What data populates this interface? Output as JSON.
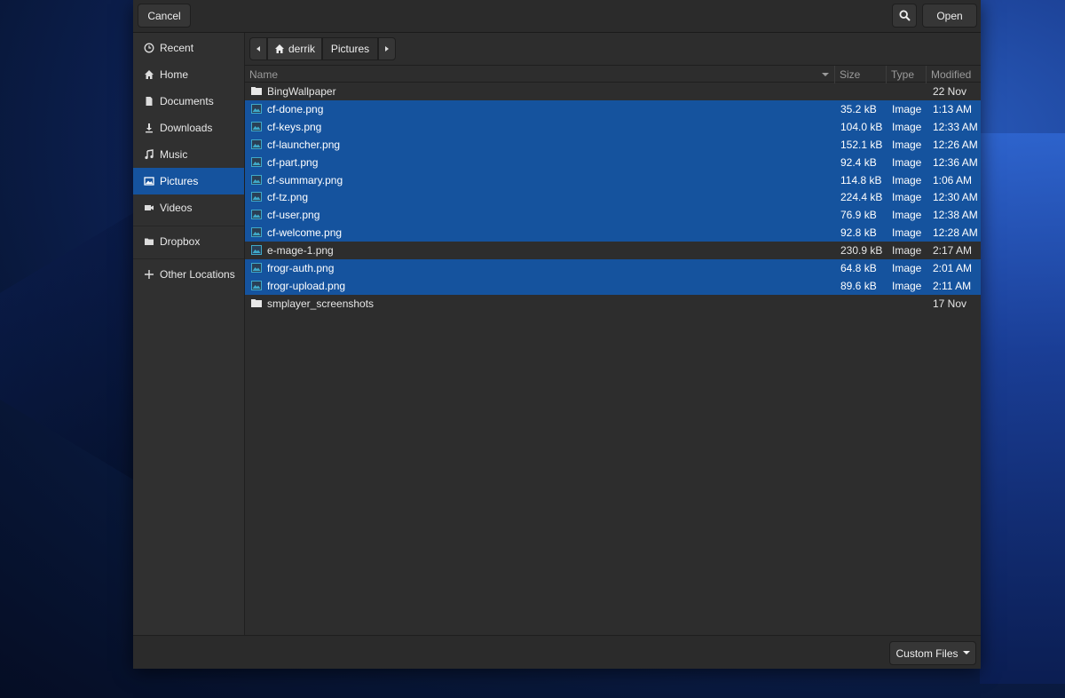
{
  "header": {
    "cancel_label": "Cancel",
    "open_label": "Open",
    "search_icon": "search-icon"
  },
  "sidebar": {
    "items": [
      {
        "label": "Recent",
        "icon": "clock-icon"
      },
      {
        "label": "Home",
        "icon": "home-icon"
      },
      {
        "label": "Documents",
        "icon": "document-icon"
      },
      {
        "label": "Downloads",
        "icon": "download-icon"
      },
      {
        "label": "Music",
        "icon": "music-icon"
      },
      {
        "label": "Pictures",
        "icon": "image-icon",
        "selected": true
      },
      {
        "label": "Videos",
        "icon": "video-icon"
      },
      {
        "label": "Dropbox",
        "icon": "folder-icon"
      },
      {
        "label": "Other Locations",
        "icon": "plus-icon"
      }
    ]
  },
  "pathbar": {
    "home_label": "derrik",
    "current_label": "Pictures"
  },
  "columns": {
    "name": "Name",
    "size": "Size",
    "type": "Type",
    "modified": "Modified"
  },
  "files": [
    {
      "name": "BingWallpaper",
      "size": "",
      "type": "",
      "modified": "22 Nov",
      "kind": "folder",
      "selected": false
    },
    {
      "name": "cf-done.png",
      "size": "35.2 kB",
      "type": "Image",
      "modified": "1:13 AM",
      "kind": "image",
      "selected": true
    },
    {
      "name": "cf-keys.png",
      "size": "104.0 kB",
      "type": "Image",
      "modified": "12:33 AM",
      "kind": "image",
      "selected": true
    },
    {
      "name": "cf-launcher.png",
      "size": "152.1 kB",
      "type": "Image",
      "modified": "12:26 AM",
      "kind": "image",
      "selected": true
    },
    {
      "name": "cf-part.png",
      "size": "92.4 kB",
      "type": "Image",
      "modified": "12:36 AM",
      "kind": "image",
      "selected": true
    },
    {
      "name": "cf-summary.png",
      "size": "114.8 kB",
      "type": "Image",
      "modified": "1:06 AM",
      "kind": "image",
      "selected": true
    },
    {
      "name": "cf-tz.png",
      "size": "224.4 kB",
      "type": "Image",
      "modified": "12:30 AM",
      "kind": "image",
      "selected": true
    },
    {
      "name": "cf-user.png",
      "size": "76.9 kB",
      "type": "Image",
      "modified": "12:38 AM",
      "kind": "image",
      "selected": true
    },
    {
      "name": "cf-welcome.png",
      "size": "92.8 kB",
      "type": "Image",
      "modified": "12:28 AM",
      "kind": "image",
      "selected": true
    },
    {
      "name": "e-mage-1.png",
      "size": "230.9 kB",
      "type": "Image",
      "modified": "2:17 AM",
      "kind": "image",
      "selected": false
    },
    {
      "name": "frogr-auth.png",
      "size": "64.8 kB",
      "type": "Image",
      "modified": "2:01 AM",
      "kind": "image",
      "selected": true
    },
    {
      "name": "frogr-upload.png",
      "size": "89.6 kB",
      "type": "Image",
      "modified": "2:11 AM",
      "kind": "image",
      "selected": true
    },
    {
      "name": "smplayer_screenshots",
      "size": "",
      "type": "",
      "modified": "17 Nov",
      "kind": "folder",
      "selected": false
    }
  ],
  "footer": {
    "filter_label": "Custom Files"
  },
  "colors": {
    "selection": "#15539e",
    "dialog_bg": "#2d2d2d",
    "image_icon": "#3fa9c9"
  }
}
